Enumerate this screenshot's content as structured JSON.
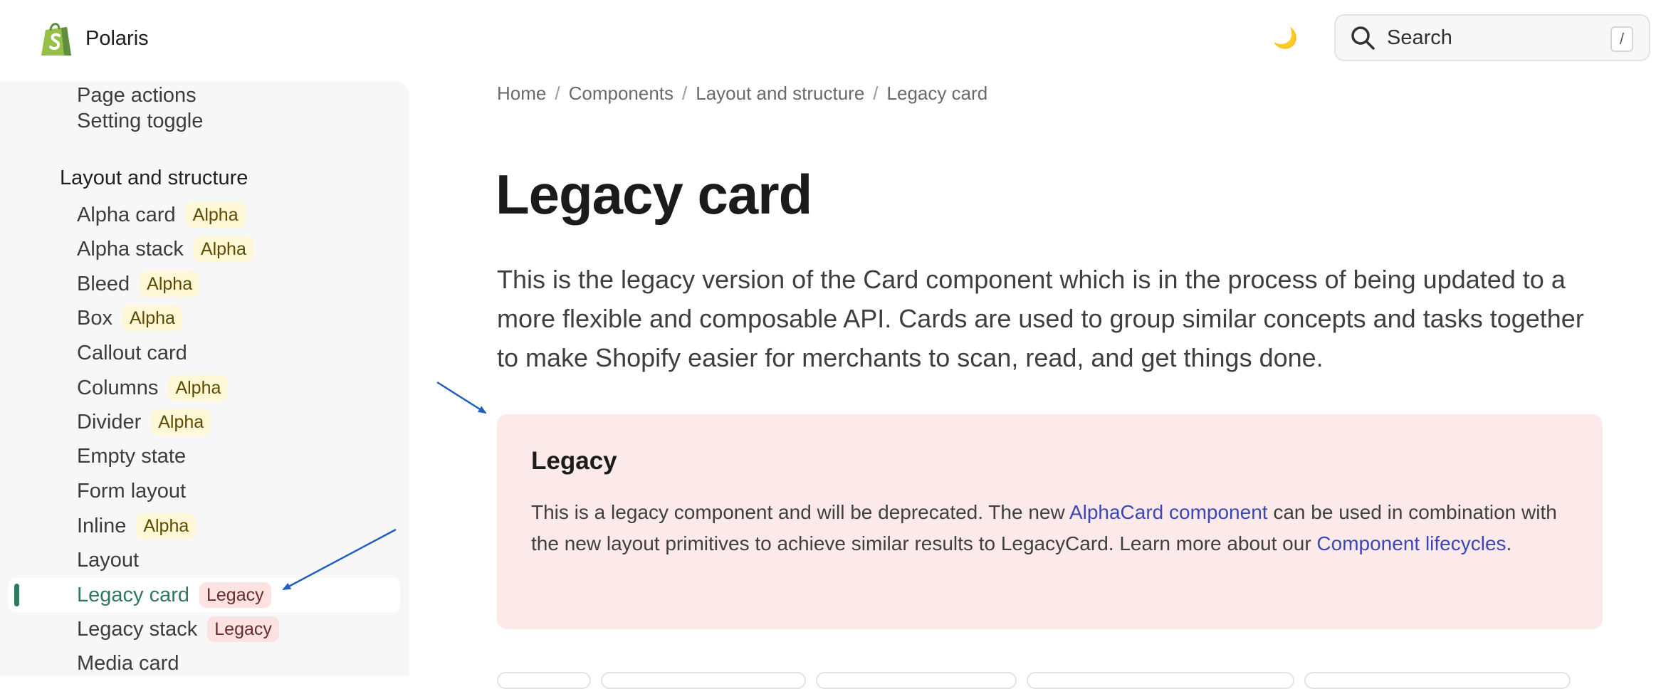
{
  "header": {
    "logo_name": "shopify-bag-icon",
    "title": "Polaris",
    "theme_icon": "moon-icon",
    "search": {
      "placeholder": "Search",
      "shortcut": "/"
    }
  },
  "sidebar": {
    "top_items": [
      "Page actions",
      "Setting toggle"
    ],
    "group_label": "Layout and structure",
    "items": [
      {
        "label": "Alpha card",
        "badge": "Alpha"
      },
      {
        "label": "Alpha stack",
        "badge": "Alpha"
      },
      {
        "label": "Bleed",
        "badge": "Alpha"
      },
      {
        "label": "Box",
        "badge": "Alpha"
      },
      {
        "label": "Callout card",
        "badge": ""
      },
      {
        "label": "Columns",
        "badge": "Alpha"
      },
      {
        "label": "Divider",
        "badge": "Alpha"
      },
      {
        "label": "Empty state",
        "badge": ""
      },
      {
        "label": "Form layout",
        "badge": ""
      },
      {
        "label": "Inline",
        "badge": "Alpha"
      },
      {
        "label": "Layout",
        "badge": ""
      },
      {
        "label": "Legacy card",
        "badge": "Legacy",
        "active": true
      },
      {
        "label": "Legacy stack",
        "badge": "Legacy"
      },
      {
        "label": "Media card",
        "badge": ""
      }
    ]
  },
  "breadcrumb": [
    "Home",
    "Components",
    "Layout and structure",
    "Legacy card"
  ],
  "breadcrumb_separator": "/",
  "page": {
    "title": "Legacy card",
    "intro": "This is the legacy version of the Card component which is in the process of being updated to a more flexible and composable API. Cards are used to group similar concepts and tasks together to make Shopify easier for merchants to scan, read, and get things done."
  },
  "callout": {
    "title": "Legacy",
    "text_1": "This is a legacy component and will be deprecated. The new ",
    "link_1": "AlphaCard component",
    "text_2": " can be used in combination with the new layout primitives to achieve similar results to LegacyCard. Learn more about our ",
    "link_2": "Component lifecycles",
    "text_3": "."
  },
  "colors": {
    "accent_green": "#2f7a5b",
    "link_blue": "#3b47b8",
    "callout_bg": "#fbeae9",
    "alpha_badge_bg": "#fff8d6",
    "legacy_badge_bg": "#fde2e2",
    "annotation_arrow": "#1f5fbf"
  }
}
